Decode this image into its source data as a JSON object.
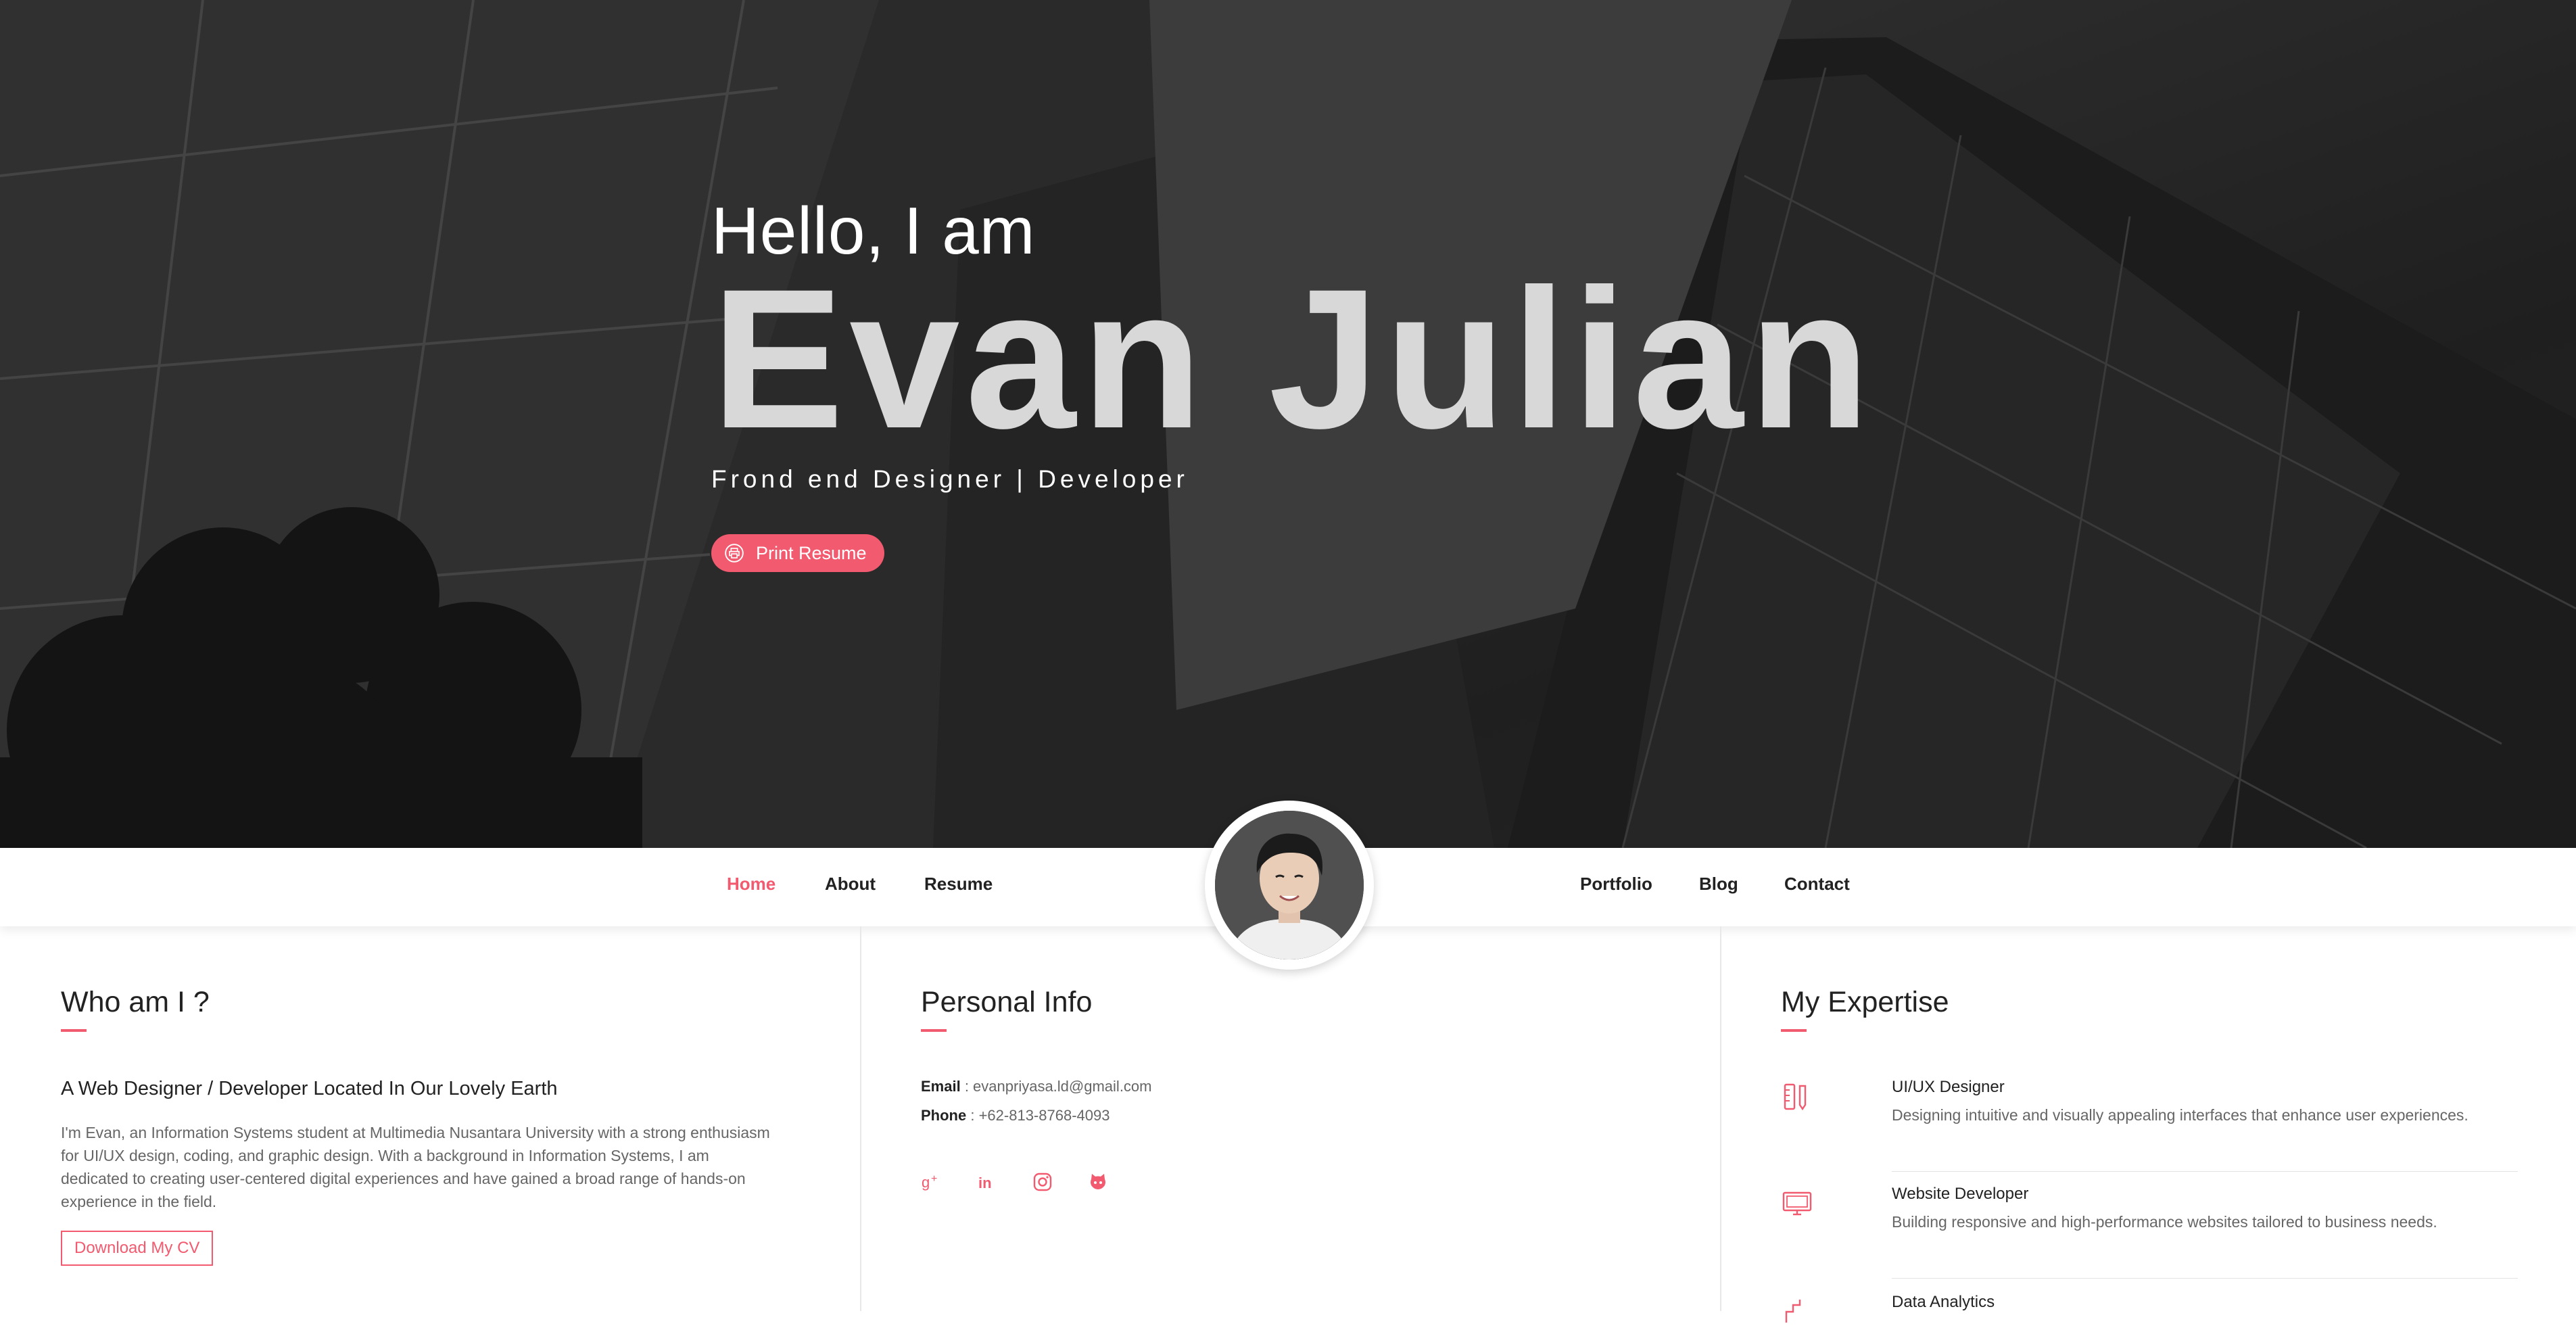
{
  "hero": {
    "greeting": "Hello, I am",
    "name": "Evan Julian",
    "subtitle": "Frond end Designer | Developer",
    "print_button": "Print Resume"
  },
  "nav": {
    "left": [
      "Home",
      "About",
      "Resume"
    ],
    "right": [
      "Portfolio",
      "Blog",
      "Contact"
    ],
    "active": "Home"
  },
  "who": {
    "title": "Who am I ?",
    "subtitle": "A Web Designer / Developer Located In Our Lovely Earth",
    "body": "I'm Evan, an Information Systems student at Multimedia Nusantara University with a strong enthusiasm for UI/UX design, coding, and graphic design. With a background in Information Systems, I am dedicated to creating user-centered digital experiences and have gained a broad range of hands-on experience in the field.",
    "cv_button": "Download My CV"
  },
  "personal": {
    "title": "Personal Info",
    "email_label": "Email",
    "email": "evanpriyasa.ld@gmail.com",
    "phone_label": "Phone",
    "phone": "+62-813-8768-4093",
    "socials": [
      "google-plus-icon",
      "linkedin-icon",
      "instagram-icon",
      "github-icon"
    ]
  },
  "expertise": {
    "title": "My Expertise",
    "items": [
      {
        "title": "UI/UX Designer",
        "desc": "Designing intuitive and visually appealing interfaces that enhance user experiences.",
        "icon": "design-tools-icon"
      },
      {
        "title": "Website Developer",
        "desc": "Building responsive and high-performance websites tailored to business needs.",
        "icon": "monitor-icon"
      },
      {
        "title": "Data Analytics",
        "desc": "",
        "icon": "chart-icon"
      }
    ]
  },
  "colors": {
    "accent": "#f25a6f",
    "hero_bg": "#2b2b2b",
    "text_dark": "#222222",
    "text_muted": "#666666"
  }
}
